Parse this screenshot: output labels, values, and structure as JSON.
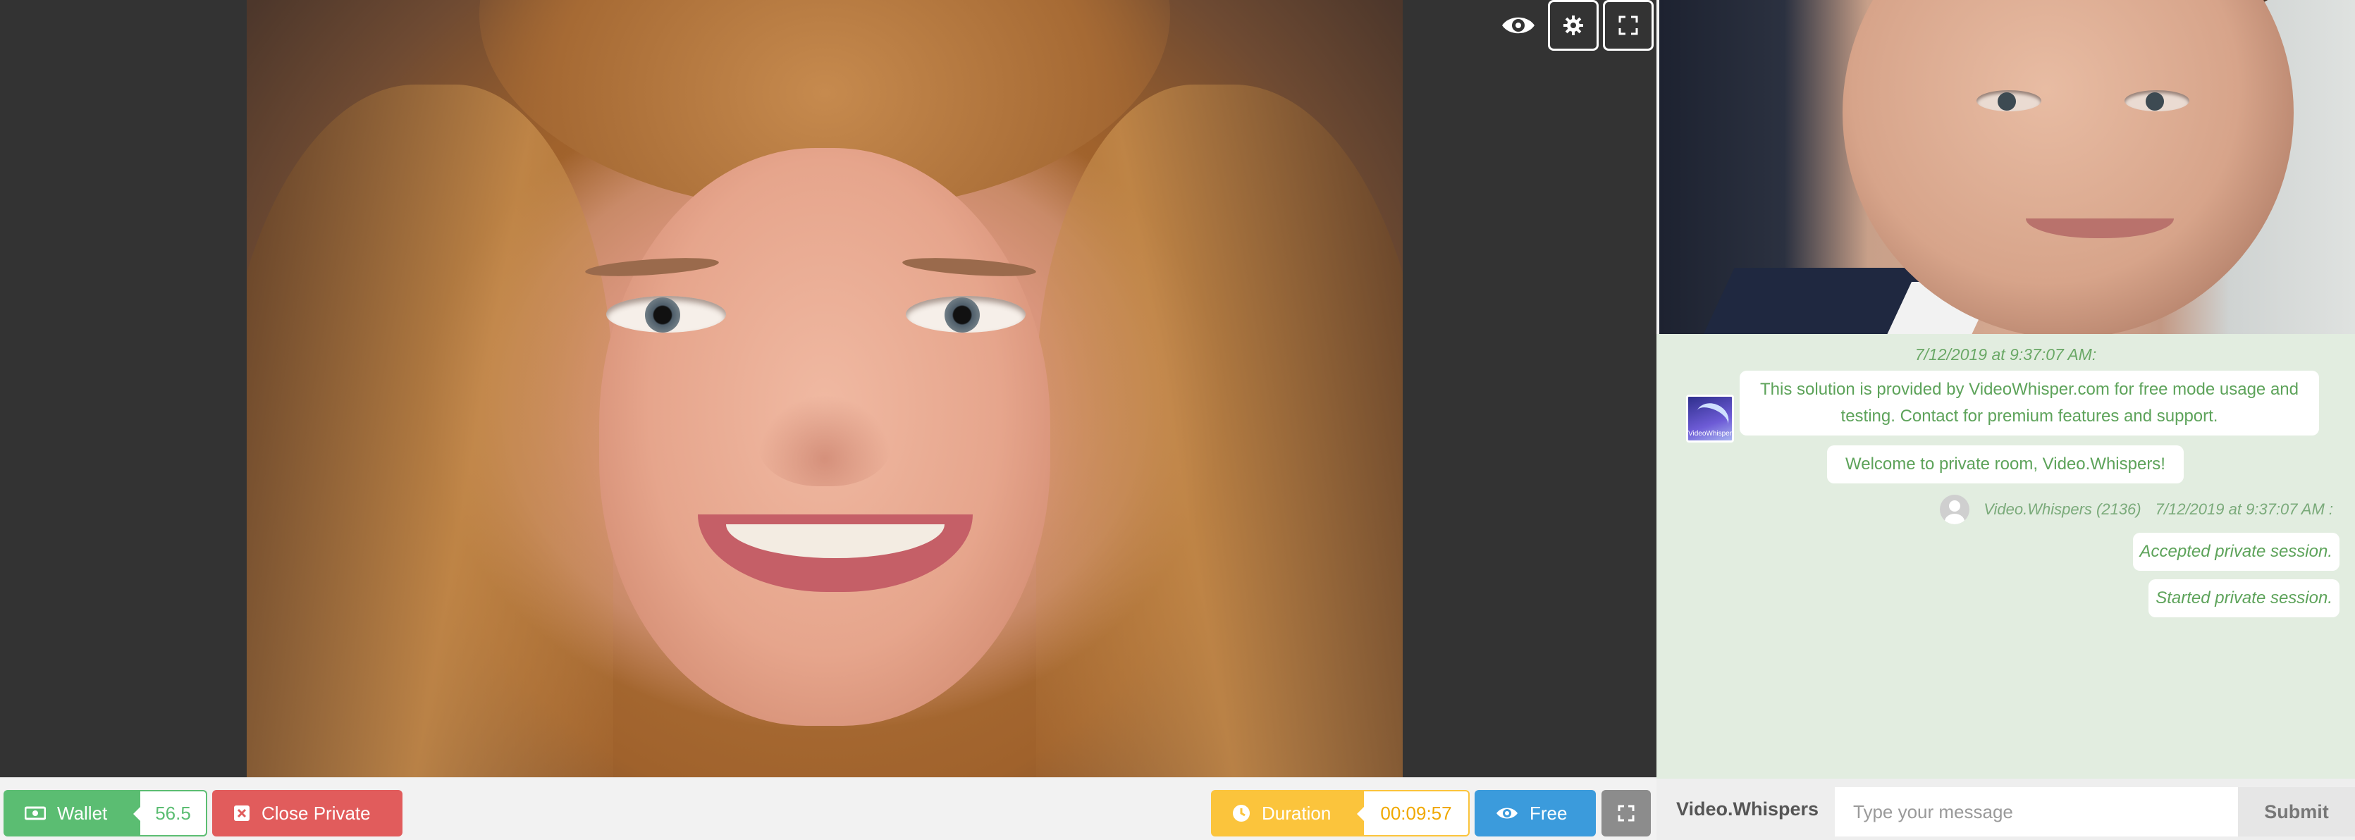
{
  "main_video": {
    "controls": {
      "visibility_icon": "eye-icon",
      "settings_icon": "gear-icon",
      "fullscreen_icon": "expand-icon"
    }
  },
  "chat": {
    "timestamp": "7/12/2019 at 9:37:07 AM:",
    "avatar_caption": "VideoWhisper",
    "system_message": "This solution is provided by VideoWhisper.com for free mode usage and testing. Contact for premium features and support.",
    "welcome_message": "Welcome to private room, Video.Whispers!",
    "sender_meta": {
      "name": "Video.Whispers (2136)",
      "time": "7/12/2019 at 9:37:07 AM :"
    },
    "messages": [
      "Accepted private session.",
      "Started private session."
    ],
    "colors": {
      "text": "#5da35a",
      "background": "#e2ede0"
    }
  },
  "toolbar": {
    "wallet_label": "Wallet",
    "wallet_value": "56.5",
    "close_private_label": "Close Private",
    "duration_label": "Duration",
    "duration_value": "00:09:57",
    "free_label": "Free",
    "colors": {
      "wallet": "#5bbd72",
      "close": "#e15c5c",
      "duration": "#fbc43c",
      "free": "#3b9bdc"
    }
  },
  "chat_input": {
    "username": "Video.Whispers",
    "placeholder": "Type your message",
    "submit_label": "Submit"
  }
}
